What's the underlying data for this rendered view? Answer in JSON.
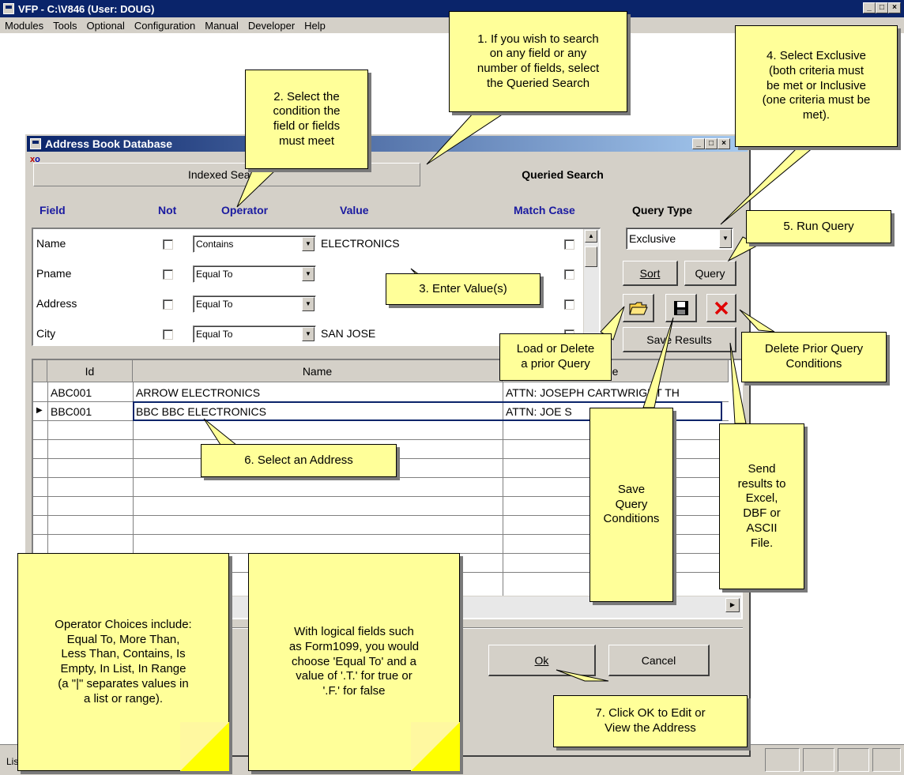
{
  "main_window": {
    "title": "VFP - C:\\V846  (User: DOUG)",
    "menu": [
      "Modules",
      "Tools",
      "Optional",
      "Configuration",
      "Manual",
      "Developer",
      "Help"
    ],
    "status_text": "Lis"
  },
  "dialog": {
    "title": "Address Book Database",
    "tabs": {
      "indexed": "Indexed Search",
      "queried": "Queried Search"
    },
    "column_headers": {
      "field": "Field",
      "not": "Not",
      "operator": "Operator",
      "value": "Value",
      "match_case": "Match Case",
      "query_type": "Query Type"
    },
    "criteria": [
      {
        "field": "Name",
        "operator": "Contains",
        "value": "ELECTRONICS"
      },
      {
        "field": "Pname",
        "operator": "Equal To",
        "value": ""
      },
      {
        "field": "Address",
        "operator": "Equal To",
        "value": ""
      },
      {
        "field": "City",
        "operator": "Equal To",
        "value": "SAN JOSE"
      }
    ],
    "query_type_value": "Exclusive",
    "buttons": {
      "sort": "Sort",
      "query": "Query",
      "save_results": "Save Results",
      "ok": "Ok",
      "cancel": "Cancel"
    },
    "icons": {
      "open": "open-folder-icon",
      "save": "floppy-disk-icon",
      "delete": "red-x-icon"
    },
    "grid": {
      "headers": [
        "Id",
        "Name",
        "e"
      ],
      "rows": [
        {
          "id": "ABC001",
          "name": "ARROW ELECTRONICS",
          "attn": "ATTN: JOSEPH CARTWRIGHT TH"
        },
        {
          "id": "BBC001",
          "name": "BBC BBC ELECTRONICS",
          "attn": "ATTN: JOE S"
        }
      ]
    }
  },
  "callouts": {
    "c1": [
      "1. If you wish to search",
      "on any field or any",
      "number of fields, select",
      "the Queried Search"
    ],
    "c2": [
      "2. Select the",
      "condition the",
      "field or fields",
      "must meet"
    ],
    "c3": [
      "3. Enter Value(s)"
    ],
    "c4": [
      "4. Select Exclusive",
      "(both criteria must",
      "be met or Inclusive",
      "(one criteria must be",
      "met)."
    ],
    "c5": [
      "5.  Run Query"
    ],
    "c6": [
      "6. Select an Address"
    ],
    "c7": [
      "7. Click OK to Edit or",
      "View the Address"
    ],
    "load": [
      "Load or Delete",
      "a prior Query"
    ],
    "delete": [
      "Delete Prior Query",
      "Conditions"
    ],
    "save": [
      "Save",
      "Query",
      "Conditions"
    ],
    "send": [
      "Send",
      "results to",
      "Excel,",
      "DBF or",
      "ASCII",
      "File."
    ],
    "operator": [
      "Operator Choices include:",
      "Equal To, More Than,",
      "Less Than, Contains, Is",
      "Empty, In List, In Range",
      "(a \"|\" separates values in",
      "a list or range)."
    ],
    "logical": [
      "With logical fields such",
      "as Form1099, you would",
      "choose 'Equal To' and a",
      "value of '.T.' for true or",
      "'.F.' for false"
    ]
  }
}
